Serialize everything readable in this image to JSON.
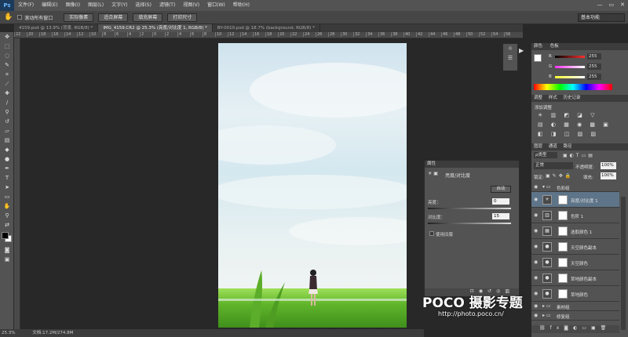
{
  "app": {
    "logo": "Ps"
  },
  "menubar": {
    "items": [
      "文件(F)",
      "编辑(E)",
      "图像(I)",
      "图层(L)",
      "文字(Y)",
      "选择(S)",
      "滤镜(T)",
      "视图(V)",
      "窗口(W)",
      "帮助(H)"
    ],
    "window_controls": [
      "—",
      "▭",
      "✕"
    ]
  },
  "options": {
    "checkbox_label": "滚动所有窗口",
    "buttons": [
      "实际像素",
      "适合屏幕",
      "填充屏幕",
      "打印尺寸"
    ],
    "workspace": "基本功能"
  },
  "tabs": [
    {
      "label": "4159.psd @ 13.9% (背景, RGB/8) *",
      "active": false
    },
    {
      "label": "IMG_4159.CR2 @ 25.3% (亮度/对比度 1, RGB/8) *",
      "active": true
    },
    {
      "label": "BY-0010.psd @ 18.7% (background, RGB/8) *",
      "active": false
    }
  ],
  "ruler_ticks": [
    "22",
    "20",
    "18",
    "16",
    "14",
    "12",
    "10",
    "8",
    "6",
    "4",
    "2",
    "0",
    "2",
    "4",
    "6",
    "8",
    "10",
    "12",
    "14",
    "16",
    "18",
    "20",
    "22",
    "24",
    "26",
    "28",
    "30",
    "32",
    "34",
    "36",
    "38",
    "40",
    "42",
    "44",
    "46",
    "48",
    "50",
    "52",
    "54",
    "56"
  ],
  "properties": {
    "tab": "属性",
    "title": "亮度/对比度",
    "auto_button": "自动",
    "brightness_label": "亮度：",
    "brightness_value": "0",
    "contrast_label": "对比度：",
    "contrast_value": "15",
    "legacy_label": "使用旧版"
  },
  "color_panel": {
    "tabs": [
      "颜色",
      "色板"
    ],
    "channels": [
      {
        "label": "R",
        "value": "255",
        "color": "#ff4040"
      },
      {
        "label": "G",
        "value": "255",
        "color": "#40e040"
      },
      {
        "label": "B",
        "value": "255",
        "color": "#4060ff"
      }
    ]
  },
  "adjustments_panel": {
    "tabs": [
      "调整",
      "样式",
      "历史记录"
    ],
    "title": "添加调整",
    "icons_row1": [
      "☀",
      "▥",
      "◩",
      "◪",
      "▽"
    ],
    "icons_row2": [
      "▤",
      "◐",
      "▦",
      "◉",
      "▩",
      "▣"
    ],
    "icons_row3": [
      "◧",
      "◨",
      "◫",
      "▧",
      "▨"
    ]
  },
  "layers_panel": {
    "tabs": [
      "图层",
      "通道",
      "路径"
    ],
    "kind_label": "ρ类型",
    "blend_mode": "正常",
    "opacity_label": "不透明度:",
    "opacity_value": "100%",
    "lock_label": "锁定:",
    "fill_label": "填充:",
    "fill_value": "100%",
    "group_name": "色彩组",
    "layers": [
      {
        "name": "亮度/对比度 1",
        "icon": "☀",
        "selected": true
      },
      {
        "name": "色阶 1",
        "icon": "▥",
        "selected": false
      },
      {
        "name": "选取颜色 1",
        "icon": "▦",
        "selected": false
      },
      {
        "name": "天空颜色副本",
        "icon": "●",
        "selected": false
      },
      {
        "name": "天空颜色",
        "icon": "●",
        "selected": false
      },
      {
        "name": "草地颜色副本",
        "icon": "●",
        "selected": false
      },
      {
        "name": "草地颜色",
        "icon": "●",
        "selected": false
      }
    ],
    "groups_bottom": [
      "素材组",
      "修复组"
    ]
  },
  "status": {
    "zoom": "25.3%",
    "doc": "文档:17.2M/274.8M"
  },
  "watermark": {
    "brand": "POCO 摄影专题",
    "url": "http://photo.poco.cn/"
  }
}
